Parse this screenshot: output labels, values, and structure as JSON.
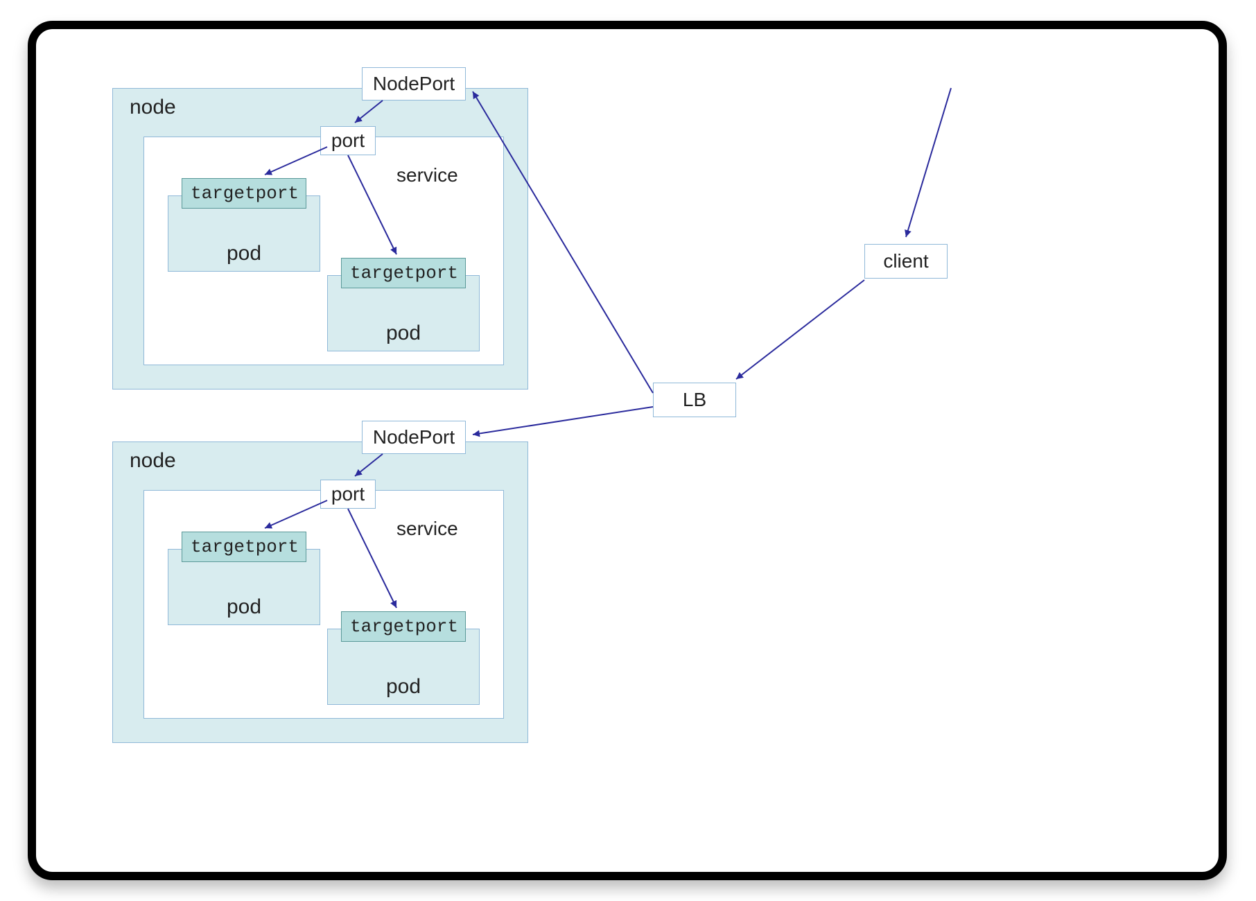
{
  "labels": {
    "nodeport": "NodePort",
    "port": "port",
    "service": "service",
    "node": "node",
    "pod": "pod",
    "targetport": "targetport",
    "lb": "LB",
    "client": "client"
  },
  "colors": {
    "node_fill": "#d8ecef",
    "box_border": "#8fb8d8",
    "targetport_fill": "#b6dede",
    "targetport_border": "#5a9898",
    "arrow": "#2a2a9c"
  }
}
